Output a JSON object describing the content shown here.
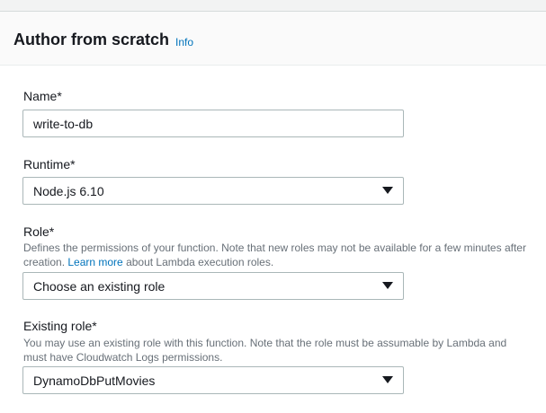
{
  "header": {
    "title": "Author from scratch",
    "info_link": "Info"
  },
  "form": {
    "name": {
      "label": "Name*",
      "value": "write-to-db"
    },
    "runtime": {
      "label": "Runtime*",
      "selected": "Node.js 6.10"
    },
    "role": {
      "label": "Role*",
      "description_before": "Defines the permissions of your function. Note that new roles may not be available for a few minutes after creation. ",
      "description_link": "Learn more",
      "description_after": " about Lambda execution roles.",
      "selected": "Choose an existing role"
    },
    "existing_role": {
      "label": "Existing role*",
      "description": "You may use an existing role with this function. Note that the role must be assumable by Lambda and must have Cloudwatch Logs permissions.",
      "selected": "DynamoDbPutMovies"
    }
  },
  "colors": {
    "link": "#0073bb",
    "header_bg": "#fafafa",
    "border": "#aab7b8",
    "description_text": "#687078"
  },
  "icons": {
    "dropdown": "caret-down-icon"
  }
}
